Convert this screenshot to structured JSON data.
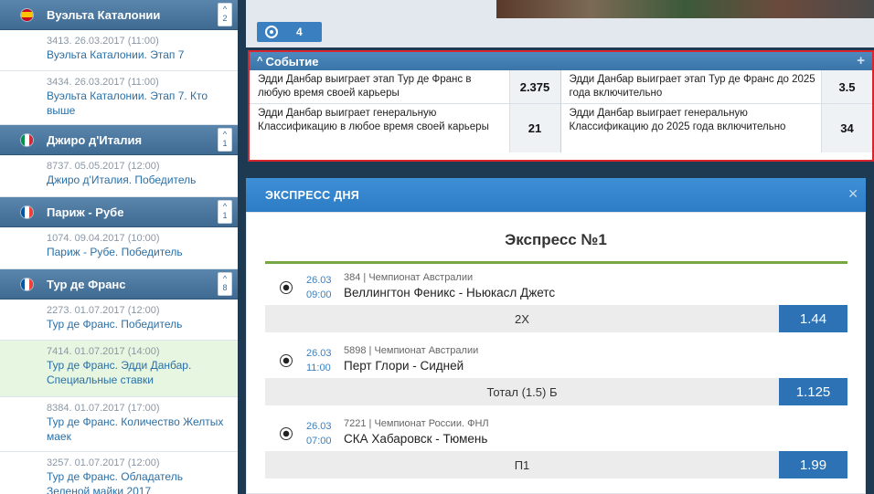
{
  "sidebar": {
    "categories": [
      {
        "title": "Вуэльта Каталонии",
        "count": "2",
        "flag": "spain-flag-icon",
        "items": [
          {
            "meta": "3413. 26.03.2017 (11:00)",
            "title": "Вуэльта Каталонии. Этап 7"
          },
          {
            "meta": "3434. 26.03.2017 (11:00)",
            "title": "Вуэльта Каталонии. Этап 7. Кто выше"
          }
        ]
      },
      {
        "title": "Джиро д'Италия",
        "count": "1",
        "flag": "italy-flag-icon",
        "items": [
          {
            "meta": "8737. 05.05.2017 (12:00)",
            "title": "Джиро д'Италия. Победитель"
          }
        ]
      },
      {
        "title": "Париж - Рубе",
        "count": "1",
        "flag": "france-flag-icon",
        "items": [
          {
            "meta": "1074. 09.04.2017 (10:00)",
            "title": "Париж - Рубе. Победитель"
          }
        ]
      },
      {
        "title": "Тур де Франс",
        "count": "8",
        "flag": "france-flag-icon",
        "items": [
          {
            "meta": "2273. 01.07.2017 (12:00)",
            "title": "Тур де Франс. Победитель"
          },
          {
            "meta": "7414. 01.07.2017 (14:00)",
            "title": "Тур де Франс. Эдди Данбар. Специальные ставки"
          },
          {
            "meta": "8384. 01.07.2017 (17:00)",
            "title": "Тур де Франс. Количество Желтых маек"
          },
          {
            "meta": "3257. 01.07.2017 (12:00)",
            "title": "Тур де Франс. Обладатель Зеленой майки 2017"
          }
        ]
      }
    ]
  },
  "stats_tab": {
    "count": "4",
    "icon": "target-icon"
  },
  "event": {
    "title": "Событие",
    "outcomes": [
      {
        "name": "Эдди Данбар выиграет этап Тур де Франс в любую время своей карьеры",
        "odd": "2.375"
      },
      {
        "name": "Эдди Данбар выиграет этап Тур де Франс до 2025 года включительно",
        "odd": "3.5"
      },
      {
        "name": "Эдди Данбар выиграет генеральную Классификацию в любое время своей карьеры",
        "odd": "21"
      },
      {
        "name": "Эдди Данбар выиграет генеральную Классификацию до 2025 года включительно",
        "odd": "34"
      }
    ]
  },
  "express": {
    "header": "ЭКСПРЕСС ДНЯ",
    "title": "Экспресс №1",
    "matches": [
      {
        "date": "26.03",
        "time": "09:00",
        "league": "384 | Чемпионат Австралии",
        "teams": "Веллингтон Феникс - Ньюкасл Джетс",
        "bet": "2Х",
        "odd": "1.44"
      },
      {
        "date": "26.03",
        "time": "11:00",
        "league": "5898 | Чемпионат Австралии",
        "teams": "Перт Глори - Сидней",
        "bet": "Тотал (1.5) Б",
        "odd": "1.125"
      },
      {
        "date": "26.03",
        "time": "07:00",
        "league": "7221 | Чемпионат России. ФНЛ",
        "teams": "СКА Хабаровск - Тюмень",
        "bet": "П1",
        "odd": "1.99"
      }
    ]
  }
}
